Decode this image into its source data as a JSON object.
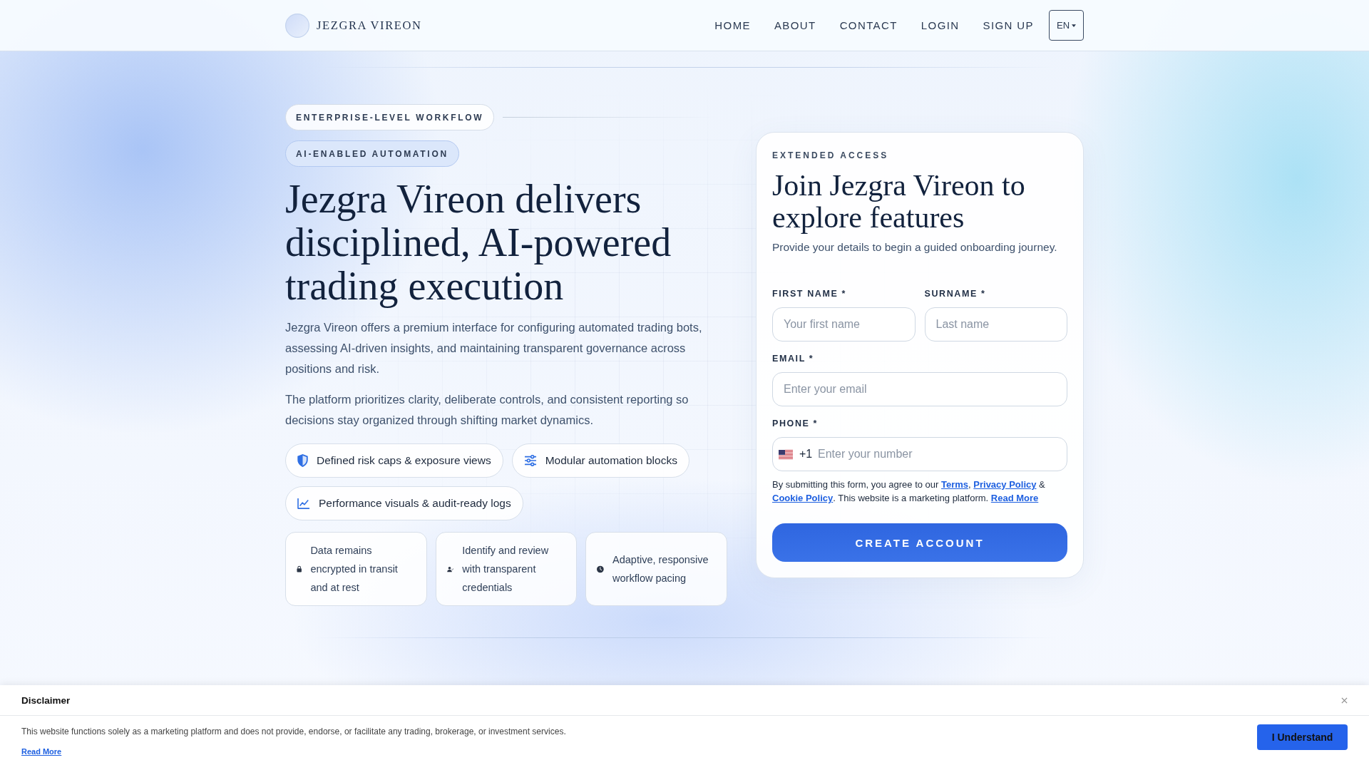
{
  "header": {
    "brand": "JEZGRA VIREON",
    "nav": [
      {
        "label": "HOME"
      },
      {
        "label": "ABOUT"
      },
      {
        "label": "CONTACT"
      },
      {
        "label": "LOGIN"
      },
      {
        "label": "SIGN UP"
      }
    ],
    "language": "EN"
  },
  "hero": {
    "badges": [
      {
        "label": "ENTERPRISE-LEVEL WORKFLOW",
        "kind": "plain"
      },
      {
        "label": "AI-ENABLED AUTOMATION",
        "kind": "accent"
      }
    ],
    "title": "Jezgra Vireon delivers disciplined, AI-powered trading execution",
    "paragraphs": [
      "Jezgra Vireon offers a premium interface for configuring automated trading bots, assessing AI-driven insights, and maintaining transparent governance across positions and risk.",
      "The platform prioritizes clarity, deliberate controls, and consistent reporting so decisions stay organized through shifting market dynamics."
    ],
    "features": [
      {
        "label": "Defined risk caps & exposure views"
      },
      {
        "label": "Modular automation blocks"
      },
      {
        "label": "Performance visuals & audit-ready logs"
      }
    ],
    "cards": [
      {
        "text": "Data remains encrypted in transit and at rest"
      },
      {
        "text": "Identify and review with transparent credentials"
      },
      {
        "text": "Adaptive, responsive workflow pacing"
      }
    ]
  },
  "form": {
    "eyebrow": "EXTENDED ACCESS",
    "title": "Join Jezgra Vireon to explore features",
    "subtitle": "Provide your details to begin a guided onboarding journey.",
    "fields": [
      {
        "label": "FIRST NAME *",
        "kind": "name",
        "placeholder": "Your first name"
      },
      {
        "label": "SURNAME *",
        "kind": "name",
        "placeholder": "Last name"
      },
      {
        "label": "EMAIL *",
        "kind": "email",
        "placeholder": "Enter your email"
      },
      {
        "label": "PHONE *",
        "kind": "phone",
        "dial_code": "+1",
        "placeholder": "Enter your number"
      }
    ],
    "consent": [
      {
        "kind": "text",
        "text": "By submitting this form, you agree to our "
      },
      {
        "kind": "link",
        "text": "Terms"
      },
      {
        "kind": "text",
        "text": ", "
      },
      {
        "kind": "link",
        "text": "Privacy Policy"
      },
      {
        "kind": "text",
        "text": " & "
      },
      {
        "kind": "link",
        "text": "Cookie Policy"
      },
      {
        "kind": "text",
        "text": ". This website is a marketing platform. "
      },
      {
        "kind": "link",
        "text": "Read More"
      }
    ],
    "submit": "CREATE ACCOUNT"
  },
  "disclaimer": {
    "title": "Disclaimer",
    "text": "This website functions solely as a marketing platform and does not provide, endorse, or facilitate any trading, brokerage, or investment services.",
    "link": "Read More",
    "button": "I Understand"
  }
}
